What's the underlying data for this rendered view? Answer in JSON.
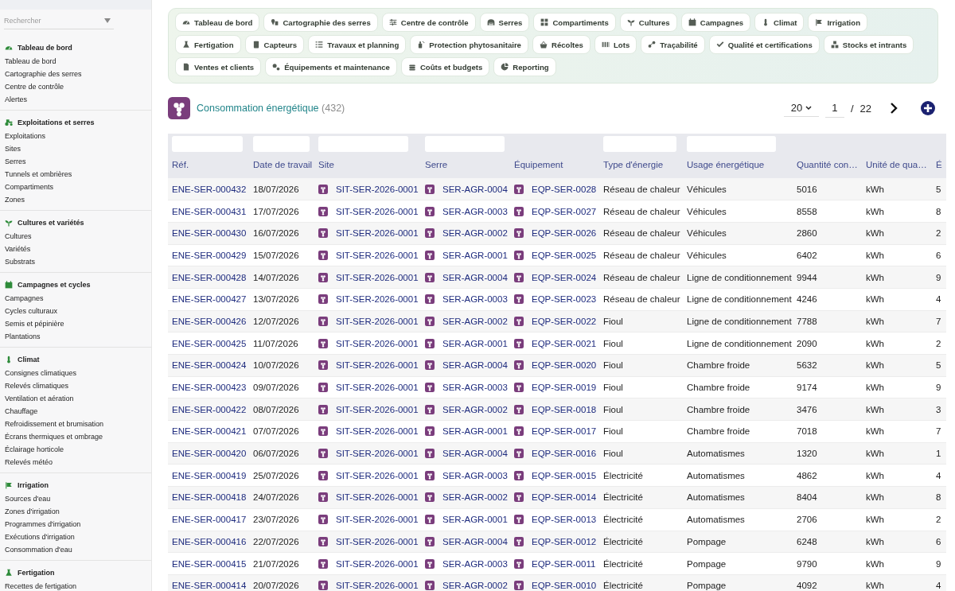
{
  "sidebar": {
    "search": {
      "placeholder": "Rechercher"
    },
    "sections": [
      {
        "title": "Tableau de bord",
        "items": [
          "Tableau de bord",
          "Cartographie des serres",
          "Centre de contrôle",
          "Alertes"
        ]
      },
      {
        "title": "Exploitations et serres",
        "items": [
          "Exploitations",
          "Sites",
          "Serres",
          "Tunnels et ombrières",
          "Compartiments",
          "Zones"
        ]
      },
      {
        "title": "Cultures et variétés",
        "items": [
          "Cultures",
          "Variétés",
          "Substrats"
        ]
      },
      {
        "title": "Campagnes et cycles",
        "items": [
          "Campagnes",
          "Cycles culturaux",
          "Semis et pépinière",
          "Plantations"
        ]
      },
      {
        "title": "Climat",
        "items": [
          "Consignes climatiques",
          "Relevés climatiques",
          "Ventilation et aération",
          "Chauffage",
          "Refroidissement et brumisation",
          "Écrans thermiques et ombrage",
          "Éclairage horticole",
          "Relevés météo"
        ]
      },
      {
        "title": "Irrigation",
        "items": [
          "Sources d'eau",
          "Zones d'irrigation",
          "Programmes d'irrigation",
          "Exécutions d'irrigation",
          "Consommation d'eau"
        ]
      },
      {
        "title": "Fertigation",
        "items": [
          "Recettes de fertigation"
        ]
      }
    ]
  },
  "nav": {
    "items": [
      "Tableau de bord",
      "Cartographie des serres",
      "Centre de contrôle",
      "Serres",
      "Compartiments",
      "Cultures",
      "Campagnes",
      "Climat",
      "Irrigation",
      "Fertigation",
      "Capteurs",
      "Travaux et planning",
      "Protection phytosanitaire",
      "Récoltes",
      "Lots",
      "Traçabilité",
      "Qualité et certifications",
      "Stocks et intrants",
      "Ventes et clients",
      "Équipements et maintenance",
      "Coûts et budgets",
      "Reporting"
    ]
  },
  "page": {
    "title": "Consommation énergétique",
    "count": "(432)"
  },
  "pagination": {
    "page_size": "20",
    "page": "1",
    "separator": "/",
    "total": "22"
  },
  "table": {
    "columns": [
      {
        "label": "Réf.",
        "filter": true,
        "kind": "link"
      },
      {
        "label": "Date de travail",
        "filter": true,
        "kind": "text"
      },
      {
        "label": "Site",
        "filter": true,
        "kind": "link-icon"
      },
      {
        "label": "Serre",
        "filter": true,
        "kind": "link-icon"
      },
      {
        "label": "Équipement",
        "filter": false,
        "kind": "link-icon"
      },
      {
        "label": "Type d'énergie",
        "filter": true,
        "kind": "text"
      },
      {
        "label": "Usage énergétique",
        "filter": true,
        "kind": "text"
      },
      {
        "label": "Quantité con…",
        "filter": false,
        "kind": "text"
      },
      {
        "label": "Unité de qua…",
        "filter": false,
        "kind": "text"
      },
      {
        "label": "É",
        "filter": false,
        "kind": "text"
      }
    ],
    "rows": [
      [
        "ENE-SER-000432",
        "18/07/2026",
        "SIT-SER-2026-0001",
        "SER-AGR-0004",
        "EQP-SER-0028",
        "Réseau de chaleur",
        "Véhicules",
        "5016",
        "kWh",
        "5"
      ],
      [
        "ENE-SER-000431",
        "17/07/2026",
        "SIT-SER-2026-0001",
        "SER-AGR-0003",
        "EQP-SER-0027",
        "Réseau de chaleur",
        "Véhicules",
        "8558",
        "kWh",
        "8"
      ],
      [
        "ENE-SER-000430",
        "16/07/2026",
        "SIT-SER-2026-0001",
        "SER-AGR-0002",
        "EQP-SER-0026",
        "Réseau de chaleur",
        "Véhicules",
        "2860",
        "kWh",
        "2"
      ],
      [
        "ENE-SER-000429",
        "15/07/2026",
        "SIT-SER-2026-0001",
        "SER-AGR-0001",
        "EQP-SER-0025",
        "Réseau de chaleur",
        "Véhicules",
        "6402",
        "kWh",
        "6"
      ],
      [
        "ENE-SER-000428",
        "14/07/2026",
        "SIT-SER-2026-0001",
        "SER-AGR-0004",
        "EQP-SER-0024",
        "Réseau de chaleur",
        "Ligne de conditionnement",
        "9944",
        "kWh",
        "9"
      ],
      [
        "ENE-SER-000427",
        "13/07/2026",
        "SIT-SER-2026-0001",
        "SER-AGR-0003",
        "EQP-SER-0023",
        "Réseau de chaleur",
        "Ligne de conditionnement",
        "4246",
        "kWh",
        "4"
      ],
      [
        "ENE-SER-000426",
        "12/07/2026",
        "SIT-SER-2026-0001",
        "SER-AGR-0002",
        "EQP-SER-0022",
        "Fioul",
        "Ligne de conditionnement",
        "7788",
        "kWh",
        "7"
      ],
      [
        "ENE-SER-000425",
        "11/07/2026",
        "SIT-SER-2026-0001",
        "SER-AGR-0001",
        "EQP-SER-0021",
        "Fioul",
        "Ligne de conditionnement",
        "2090",
        "kWh",
        "2"
      ],
      [
        "ENE-SER-000424",
        "10/07/2026",
        "SIT-SER-2026-0001",
        "SER-AGR-0004",
        "EQP-SER-0020",
        "Fioul",
        "Chambre froide",
        "5632",
        "kWh",
        "5"
      ],
      [
        "ENE-SER-000423",
        "09/07/2026",
        "SIT-SER-2026-0001",
        "SER-AGR-0003",
        "EQP-SER-0019",
        "Fioul",
        "Chambre froide",
        "9174",
        "kWh",
        "9"
      ],
      [
        "ENE-SER-000422",
        "08/07/2026",
        "SIT-SER-2026-0001",
        "SER-AGR-0002",
        "EQP-SER-0018",
        "Fioul",
        "Chambre froide",
        "3476",
        "kWh",
        "3"
      ],
      [
        "ENE-SER-000421",
        "07/07/2026",
        "SIT-SER-2026-0001",
        "SER-AGR-0001",
        "EQP-SER-0017",
        "Fioul",
        "Chambre froide",
        "7018",
        "kWh",
        "7"
      ],
      [
        "ENE-SER-000420",
        "06/07/2026",
        "SIT-SER-2026-0001",
        "SER-AGR-0004",
        "EQP-SER-0016",
        "Fioul",
        "Automatismes",
        "1320",
        "kWh",
        "1"
      ],
      [
        "ENE-SER-000419",
        "25/07/2026",
        "SIT-SER-2026-0001",
        "SER-AGR-0003",
        "EQP-SER-0015",
        "Électricité",
        "Automatismes",
        "4862",
        "kWh",
        "4"
      ],
      [
        "ENE-SER-000418",
        "24/07/2026",
        "SIT-SER-2026-0001",
        "SER-AGR-0002",
        "EQP-SER-0014",
        "Électricité",
        "Automatismes",
        "8404",
        "kWh",
        "8"
      ],
      [
        "ENE-SER-000417",
        "23/07/2026",
        "SIT-SER-2026-0001",
        "SER-AGR-0001",
        "EQP-SER-0013",
        "Électricité",
        "Automatismes",
        "2706",
        "kWh",
        "2"
      ],
      [
        "ENE-SER-000416",
        "22/07/2026",
        "SIT-SER-2026-0001",
        "SER-AGR-0004",
        "EQP-SER-0012",
        "Électricité",
        "Pompage",
        "6248",
        "kWh",
        "6"
      ],
      [
        "ENE-SER-000415",
        "21/07/2026",
        "SIT-SER-2026-0001",
        "SER-AGR-0003",
        "EQP-SER-0011",
        "Électricité",
        "Pompage",
        "9790",
        "kWh",
        "9"
      ],
      [
        "ENE-SER-000414",
        "20/07/2026",
        "SIT-SER-2026-0001",
        "SER-AGR-0002",
        "EQP-SER-0010",
        "Électricité",
        "Pompage",
        "4092",
        "kWh",
        "4"
      ]
    ]
  }
}
